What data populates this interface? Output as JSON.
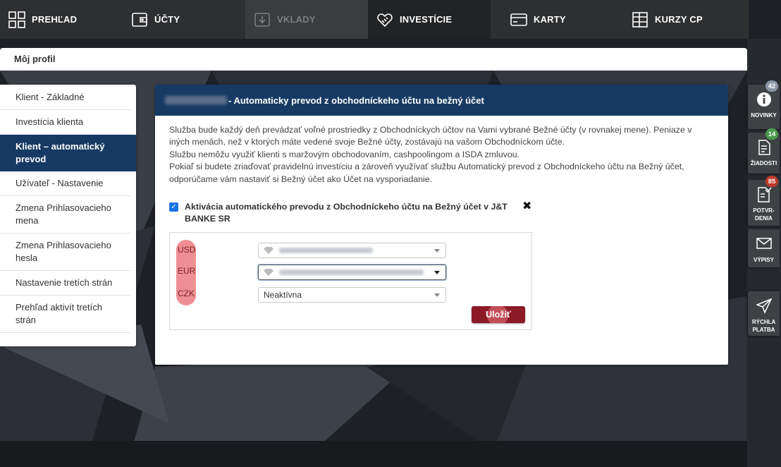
{
  "nav": {
    "items": [
      {
        "label": "PREHĽAD",
        "icon": "dashboard-grid-icon"
      },
      {
        "label": "ÚČTY",
        "icon": "wallet-icon"
      },
      {
        "label": "VKLADY",
        "icon": "deposit-icon"
      },
      {
        "label": "INVESTÍCIE",
        "icon": "handshake-heart-icon"
      },
      {
        "label": "KARTY",
        "icon": "credit-card-icon"
      },
      {
        "label": "KURZY CP",
        "icon": "table-grid-icon"
      }
    ]
  },
  "profile_title": "Môj profil",
  "sidebar": {
    "items": [
      {
        "label": "Klient - Základné"
      },
      {
        "label": "Investícia klienta"
      },
      {
        "label": "Klient – automatický prevod"
      },
      {
        "label": "Užívateľ - Nastavenie"
      },
      {
        "label": "Zmena Prihlasovacieho mena"
      },
      {
        "label": "Zmena Prihlasovacieho hesla"
      },
      {
        "label": "Nastavenie tretích strán"
      },
      {
        "label": "Prehľad aktivít tretích strán"
      }
    ],
    "active_index": 2
  },
  "panel": {
    "title": "- Automaticky prevod z obchodníckeho účtu na bežný účet",
    "description": [
      "Služba bude každý deň prevádzať voľné prostriedky z Obchodníckych účtov na Vami vybrané Bežné účty (v rovnakej mene). Peniaze v iných menách, než v ktorých máte vedené svoje Bežné účty, zostávajú na vašom Obchodníckom účte.",
      "Službu nemôžu využiť klienti s maržovým obchodovaním, cashpoolingom a ISDA zmluvou.",
      "Pokiaľ si budete zriaďovať pravidelnú investíciu a zároveň využívať službu Automatický prevod z Obchodníckeho účtu na Bežný účet, odporúčame vám nastaviť si Bežný účet ako Účet na vysporiadanie."
    ],
    "checkbox_label": "Aktivácia automatického prevodu z Obchodníckeho účtu na Bežný účet v J&T BANKE SR",
    "checkbox_checked": true,
    "close_glyph": "✖",
    "currencies": [
      {
        "code": "USD",
        "selected": ""
      },
      {
        "code": "EUR",
        "selected": ""
      },
      {
        "code": "CZK",
        "selected": "Neaktívna"
      }
    ],
    "save_label": "Uložiť"
  },
  "right_sidebar": [
    {
      "label": "NOVINKY",
      "icon": "info-icon",
      "badge": "42",
      "badge_color": "#8a96a8"
    },
    {
      "label": "ŽIADOSTI",
      "icon": "document-icon",
      "badge": "14",
      "badge_color": "#4a9a4a"
    },
    {
      "label": "POTVR-DENIA",
      "icon": "document-check-icon",
      "badge": "85",
      "badge_color": "#c0392b"
    },
    {
      "label": "VÝPISY",
      "icon": "envelope-icon",
      "badge": "",
      "badge_color": ""
    },
    {
      "label": "RÝCHLA PLATBA",
      "icon": "paper-plane-icon",
      "badge": "",
      "badge_color": ""
    }
  ],
  "colors": {
    "nav_bg": "#2e2f31",
    "primary_blue": "#163a63",
    "save_red": "#8c1a26",
    "highlight_pink": "#ef8f94"
  }
}
